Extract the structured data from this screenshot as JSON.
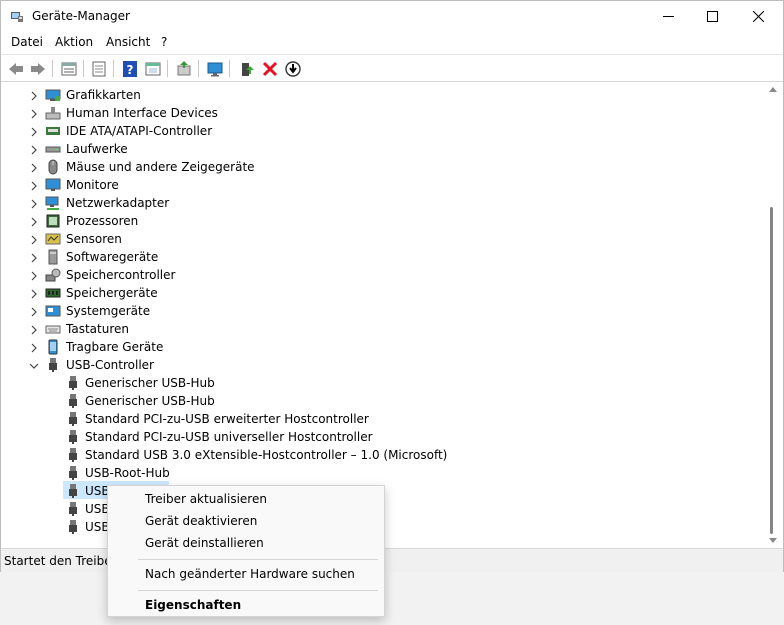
{
  "window": {
    "title": "Geräte-Manager",
    "controls": [
      "minimize",
      "maximize",
      "close"
    ]
  },
  "menu": [
    "Datei",
    "Aktion",
    "Ansicht",
    "?"
  ],
  "toolbar": {
    "buttons": [
      "back-icon",
      "forward-icon",
      "properties-list-icon",
      "properties-icon",
      "help-icon",
      "show-hidden-icon",
      "update-driver-icon",
      "scan-hardware-icon",
      "add-driver-icon",
      "uninstall-icon",
      "disable-icon"
    ]
  },
  "tree": {
    "categories": [
      {
        "label": "Grafikkarten",
        "icon": "display-adapter-icon",
        "expanded": false
      },
      {
        "label": "Human Interface Devices",
        "icon": "hid-icon",
        "expanded": false
      },
      {
        "label": "IDE ATA/ATAPI-Controller",
        "icon": "ide-controller-icon",
        "expanded": false
      },
      {
        "label": "Laufwerke",
        "icon": "disk-drive-icon",
        "expanded": false
      },
      {
        "label": "Mäuse und andere Zeigegeräte",
        "icon": "mouse-icon",
        "expanded": false
      },
      {
        "label": "Monitore",
        "icon": "monitor-icon",
        "expanded": false
      },
      {
        "label": "Netzwerkadapter",
        "icon": "network-adapter-icon",
        "expanded": false
      },
      {
        "label": "Prozessoren",
        "icon": "processor-icon",
        "expanded": false
      },
      {
        "label": "Sensoren",
        "icon": "sensor-icon",
        "expanded": false
      },
      {
        "label": "Softwaregeräte",
        "icon": "software-device-icon",
        "expanded": false
      },
      {
        "label": "Speichercontroller",
        "icon": "storage-controller-icon",
        "expanded": false
      },
      {
        "label": "Speichergeräte",
        "icon": "memory-device-icon",
        "expanded": false
      },
      {
        "label": "Systemgeräte",
        "icon": "system-device-icon",
        "expanded": false
      },
      {
        "label": "Tastaturen",
        "icon": "keyboard-icon",
        "expanded": false
      },
      {
        "label": "Tragbare Geräte",
        "icon": "portable-device-icon",
        "expanded": false
      },
      {
        "label": "USB-Controller",
        "icon": "usb-icon",
        "expanded": true
      }
    ],
    "usb_children": [
      "Generischer USB-Hub",
      "Generischer USB-Hub",
      "Standard PCI-zu-USB erweiterter Hostcontroller",
      "Standard PCI-zu-USB universeller Hostcontroller",
      "Standard USB 3.0 eXtensible-Hostcontroller – 1.0 (Microsoft)",
      "USB-Root-Hub",
      "USB-",
      "USB-",
      "USB-"
    ]
  },
  "status": {
    "text": "Startet den Treiberup"
  },
  "context_menu": {
    "items": [
      "Treiber aktualisieren",
      "Gerät deaktivieren",
      "Gerät deinstallieren"
    ],
    "scan": "Nach geänderter Hardware suchen",
    "properties": "Eigenschaften"
  },
  "colors": {
    "selection": "#cce8ff",
    "uninstall_red": "#e81123",
    "help_blue": "#1f4fb5",
    "monitor_blue": "#2f8fd6"
  }
}
